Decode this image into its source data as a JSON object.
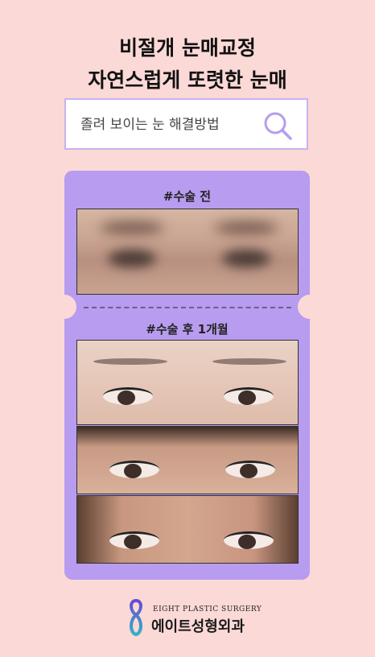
{
  "headline": {
    "line1": "비절개 눈매교정",
    "line2": "자연스럽게 또렷한 눈매"
  },
  "search": {
    "text": "졸려 보이는 눈 해결방법",
    "icon": "search-icon"
  },
  "ticket": {
    "before_label": "#수술 전",
    "after_label": "#수술 후 1개월"
  },
  "logo": {
    "english": "EIGHT PLASTIC SURGERY",
    "korean": "에이트성형외과"
  },
  "colors": {
    "background": "#fbd9d6",
    "ticket": "#b89cef",
    "search_border": "#c9b2ee"
  }
}
